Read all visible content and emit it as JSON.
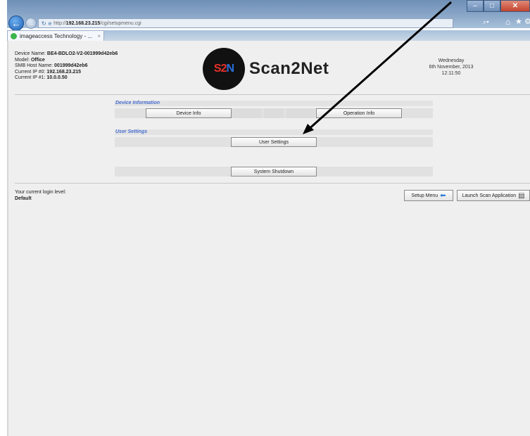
{
  "browser": {
    "url_prefix": "http://",
    "url_host": "192.168.23.215",
    "url_path": "/cgi/setupmenu.cgi",
    "tab_title": "imageaccess Technology - ...",
    "tab_close": "×"
  },
  "device": {
    "name_label": "Device Name:",
    "name_value": "BE4-BDLO2-V2-001999d42eb6",
    "model_label": "Model:",
    "model_value": "Office",
    "smb_label": "SMB Host Name:",
    "smb_value": "001999d42eb6",
    "ip0_label": "Current IP #0:",
    "ip0_value": "192.168.23.215",
    "ip1_label": "Current IP #1:",
    "ip1_value": "10.0.0.50"
  },
  "logo": {
    "mark_s": "S2",
    "mark_n": "N",
    "text": "Scan2Net"
  },
  "datetime": {
    "day": "Wednesday",
    "date": "6th November, 2013",
    "time": "12:11:50"
  },
  "sections": {
    "device_information": "Device Information",
    "user_settings": "User Settings"
  },
  "buttons": {
    "device_info": "Device Info",
    "operation_info": "Operation Info",
    "user_settings": "User Settings",
    "system_shutdown": "System Shutdown",
    "setup_menu": "Setup Menu",
    "launch_scan": "Launch Scan Application"
  },
  "login": {
    "label": "Your current login level:",
    "value": "Default"
  },
  "icons": {
    "back": "back-arrow-icon",
    "forward": "forward-arrow-icon",
    "setup_menu": "back-arrow-icon",
    "launch": "scanner-icon"
  },
  "colors": {
    "accent": "#4a6fd0",
    "logo_red": "#e9312b",
    "logo_blue": "#2a6fd8"
  }
}
